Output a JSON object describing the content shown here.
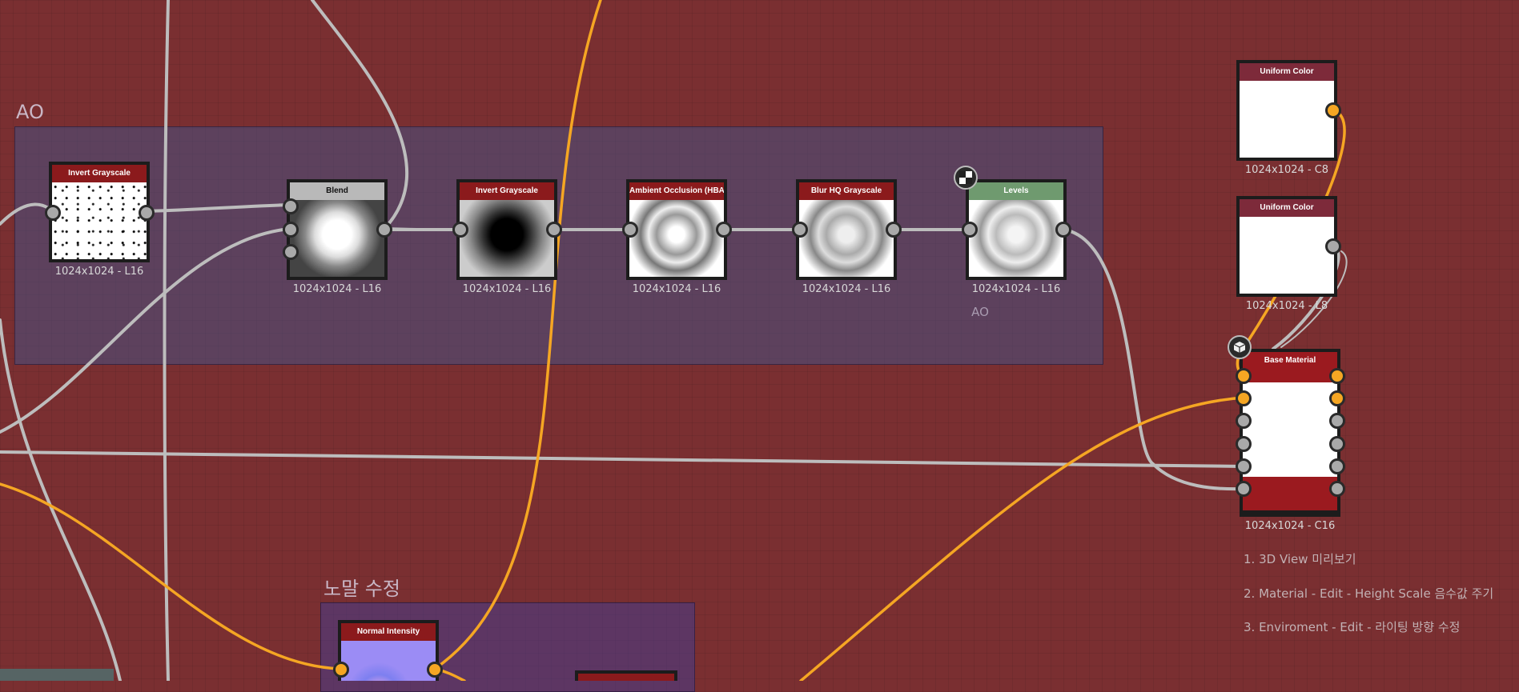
{
  "frames": {
    "ao": {
      "title": "AO"
    },
    "normal": {
      "title": "노말 수정"
    }
  },
  "nodes": {
    "invert_grayscale_1": {
      "title": "Invert Grayscale",
      "label": "1024x1024 - L16",
      "header_color": "#8b1a1c"
    },
    "blend": {
      "title": "Blend",
      "label": "1024x1024 - L16",
      "header_color": "#b9b9b9"
    },
    "invert_grayscale_2": {
      "title": "Invert Grayscale",
      "label": "1024x1024 - L16",
      "header_color": "#8b1a1c"
    },
    "ambient_occlusion": {
      "title": "Ambient Occlusion (HBAO)",
      "label": "1024x1024 - L16",
      "header_color": "#8b1a1c"
    },
    "blur_hq": {
      "title": "Blur HQ Grayscale",
      "label": "1024x1024 - L16",
      "header_color": "#8b1a1c"
    },
    "levels": {
      "title": "Levels",
      "label": "1024x1024 - L16",
      "header_color": "#6f9a6f",
      "comment": "AO"
    },
    "uniform_color_1": {
      "title": "Uniform Color",
      "label": "1024x1024 - C8",
      "header_color": "#7d2a3a"
    },
    "uniform_color_2": {
      "title": "Uniform Color",
      "label": "1024x1024 - L8",
      "header_color": "#7d2a3a"
    },
    "base_material": {
      "title": "Base Material",
      "label": "1024x1024 - C16",
      "header_color": "#9b1a1f"
    },
    "normal_intensity": {
      "title": "Normal Intensity",
      "header_color": "#8b1a1c"
    }
  },
  "notes": [
    "1. 3D View 미리보기",
    "2. Material - Edit - Height Scale 음수값 주기",
    "3. Enviroment - Edit - 라이팅 방향 수정"
  ],
  "colors": {
    "background": "#7a2f31",
    "wire_gray": "#bdbdbd",
    "wire_orange": "#f5a623",
    "frame_ao": "#5d4a6a",
    "frame_normal": "#5a3a6e"
  },
  "icons": [
    "checker-badge-icon",
    "cube-badge-icon"
  ]
}
